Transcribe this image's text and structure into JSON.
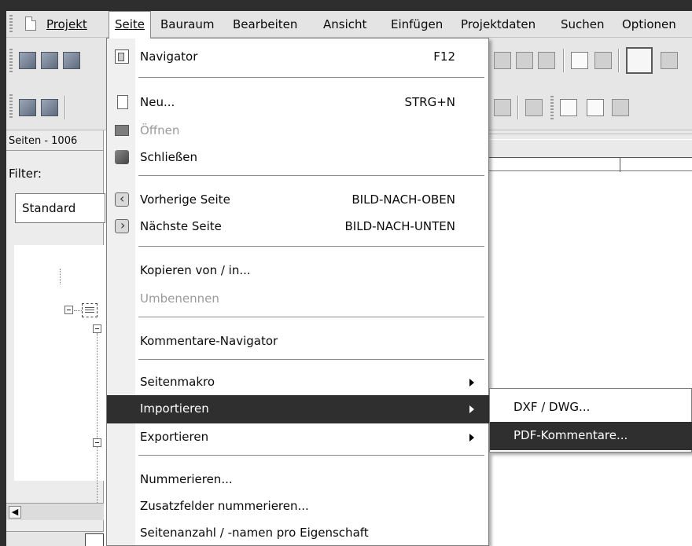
{
  "menubar": {
    "items": [
      {
        "label": "Projekt"
      },
      {
        "label": "Seite"
      },
      {
        "label": "Bauraum"
      },
      {
        "label": "Bearbeiten"
      },
      {
        "label": "Ansicht"
      },
      {
        "label": "Einfügen"
      },
      {
        "label": "Projektdaten"
      },
      {
        "label": "Suchen"
      },
      {
        "label": "Optionen"
      }
    ]
  },
  "left_panel": {
    "title": "Seiten - 1006",
    "filter_label": "Filter:",
    "filter_value": "Standard"
  },
  "dropdown": {
    "items": [
      {
        "label": "Navigator",
        "shortcut": "F12",
        "icon": "navigator-icon"
      },
      {
        "label": "Neu...",
        "shortcut": "STRG+N",
        "icon": "new-page-icon"
      },
      {
        "label": "Öffnen",
        "icon": "open-icon",
        "disabled": true
      },
      {
        "label": "Schließen",
        "icon": "close-page-icon"
      },
      {
        "label": "Vorherige Seite",
        "shortcut": "BILD-NACH-OBEN",
        "icon": "previous-page-icon"
      },
      {
        "label": "Nächste Seite",
        "shortcut": "BILD-NACH-UNTEN",
        "icon": "next-page-icon"
      },
      {
        "label": "Kopieren von / in..."
      },
      {
        "label": "Umbenennen",
        "disabled": true
      },
      {
        "label": "Kommentare-Navigator"
      },
      {
        "label": "Seitenmakro",
        "submenu": true
      },
      {
        "label": "Importieren",
        "submenu": true,
        "highlighted": true
      },
      {
        "label": "Exportieren",
        "submenu": true
      },
      {
        "label": "Nummerieren..."
      },
      {
        "label": "Zusatzfelder nummerieren..."
      },
      {
        "label": "Seitenanzahl / -namen pro Eigenschaft"
      }
    ]
  },
  "submenu": {
    "items": [
      {
        "label": "DXF / DWG..."
      },
      {
        "label": "PDF-Kommentare...",
        "highlighted": true
      }
    ]
  },
  "colors": {
    "highlight": "#2f2f2f",
    "menubar_bg": "#e4e4e4",
    "disabled_text": "#9a9a9a"
  }
}
